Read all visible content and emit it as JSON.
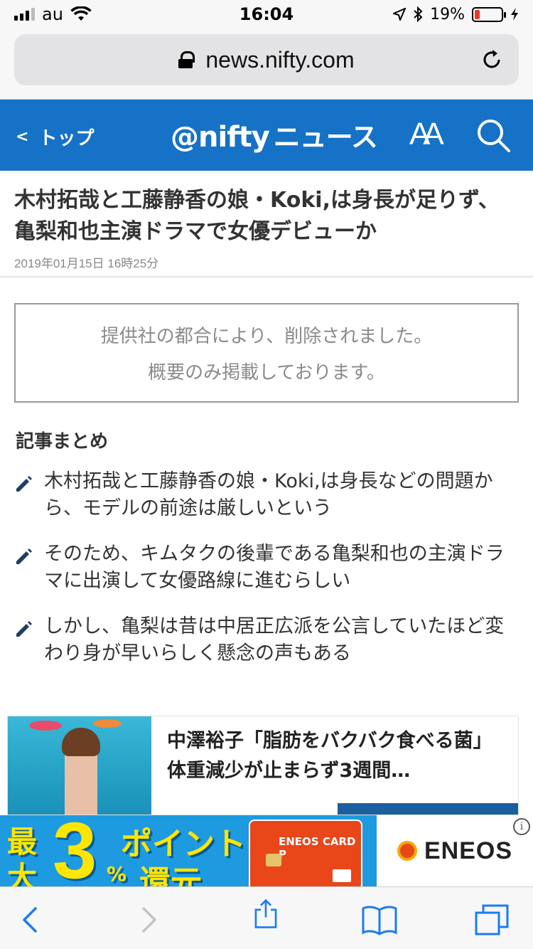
{
  "status_bar": {
    "carrier": "au",
    "time": "16:04",
    "battery_percent": "19%",
    "battery_level": 0.19
  },
  "url_bar": {
    "url": "news.nifty.com"
  },
  "site_header": {
    "back_label": "トップ",
    "logo_brand": "@nifty",
    "logo_news": "ニュース",
    "font_size_label": "AA",
    "accent_color": "#1572c6"
  },
  "article": {
    "title": "木村拓哉と工藤静香の娘・Koki,は身長が足りず、亀梨和也主演ドラマで女優デビューか",
    "date": "2019年01月15日 16時25分"
  },
  "notice": {
    "line1": "提供社の都合により、削除されました。",
    "line2": "概要のみ掲載しております。"
  },
  "summary": {
    "heading": "記事まとめ",
    "items": [
      {
        "text": "木村拓哉と工藤静香の娘・Koki,は身長などの問題から、モデルの前途は厳しいという"
      },
      {
        "text": "そのため、キムタクの後輩である亀梨和也の主演ドラマに出演して女優路線に進むらしい"
      },
      {
        "text": "しかし、亀梨は昔は中居正広派を公言していたほど変わり身が早いらしく懸念の声もある"
      }
    ]
  },
  "related": {
    "title": "中澤裕子「脂肪をバクバク食べる菌」体重減少が止まらず3週間…"
  },
  "ad": {
    "chars": [
      "最",
      "大",
      "3",
      "%",
      "ポイント",
      "還元"
    ],
    "card_label": "ENEOS CARD P",
    "brand": "ENEOS",
    "info_symbol": "i"
  },
  "toolbar": {
    "icons": [
      "back-icon",
      "forward-icon",
      "share-icon",
      "bookmarks-icon",
      "tabs-icon"
    ]
  }
}
